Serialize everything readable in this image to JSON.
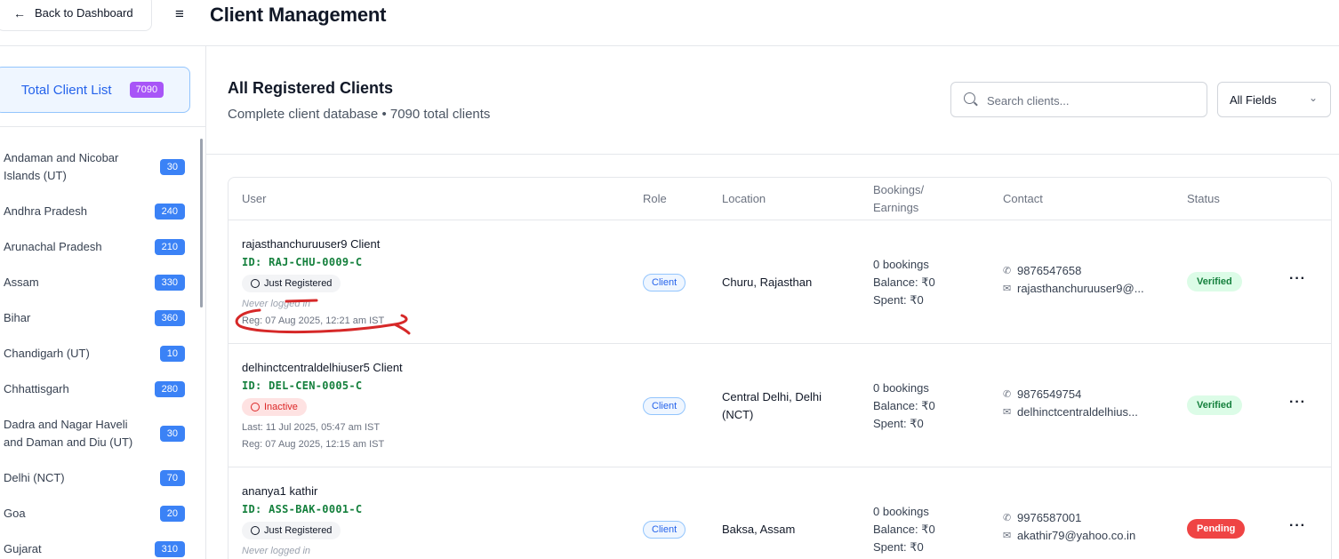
{
  "header": {
    "back_label": "Back to Dashboard",
    "title": "Client Management"
  },
  "sidebar": {
    "total_label": "Total Client List",
    "total_count": "7090",
    "items": [
      {
        "label": "Andaman and Nicobar Islands (UT)",
        "count": "30"
      },
      {
        "label": "Andhra Pradesh",
        "count": "240"
      },
      {
        "label": "Arunachal Pradesh",
        "count": "210"
      },
      {
        "label": "Assam",
        "count": "330"
      },
      {
        "label": "Bihar",
        "count": "360"
      },
      {
        "label": "Chandigarh (UT)",
        "count": "10"
      },
      {
        "label": "Chhattisgarh",
        "count": "280"
      },
      {
        "label": "Dadra and Nagar Haveli and Daman and Diu (UT)",
        "count": "30"
      },
      {
        "label": "Delhi (NCT)",
        "count": "70"
      },
      {
        "label": "Goa",
        "count": "20"
      },
      {
        "label": "Gujarat",
        "count": "310"
      }
    ]
  },
  "main": {
    "title": "All Registered Clients",
    "subtitle": "Complete client database • 7090 total clients",
    "search_placeholder": "Search clients...",
    "field_select": "All Fields"
  },
  "table": {
    "headers": {
      "user": "User",
      "role": "Role",
      "location": "Location",
      "bookings_line1": "Bookings/",
      "bookings_line2": "Earnings",
      "contact": "Contact",
      "status": "Status"
    },
    "rows": [
      {
        "name": "rajasthanchuruuser9 Client",
        "id": "ID: RAJ-CHU-0009-C",
        "tag": "Just Registered",
        "last": "Never logged in",
        "reg": "Reg: 07 Aug 2025, 12:21 am IST",
        "role": "Client",
        "location": "Churu, Rajasthan",
        "bookings": "0 bookings",
        "balance": "Balance: ₹0",
        "spent": "Spent: ₹0",
        "phone": "9876547658",
        "email": "rajasthanchuruuser9@...",
        "status": "Verified"
      },
      {
        "name": "delhinctcentraldelhiuser5 Client",
        "id": "ID: DEL-CEN-0005-C",
        "tag": "Inactive",
        "last": "Last: 11 Jul 2025, 05:47 am IST",
        "reg": "Reg: 07 Aug 2025, 12:15 am IST",
        "role": "Client",
        "location": "Central Delhi, Delhi (NCT)",
        "bookings": "0 bookings",
        "balance": "Balance: ₹0",
        "spent": "Spent: ₹0",
        "phone": "9876549754",
        "email": "delhinctcentraldelhius...",
        "status": "Verified"
      },
      {
        "name": "ananya1 kathir",
        "id": "ID: ASS-BAK-0001-C",
        "tag": "Just Registered",
        "last": "Never logged in",
        "role": "Client",
        "location": "Baksa, Assam",
        "bookings": "0 bookings",
        "balance": "Balance: ₹0",
        "spent": "Spent: ₹0",
        "phone": "9976587001",
        "email": "akathir79@yahoo.co.in",
        "status": "Pending"
      }
    ],
    "more_menu": "···"
  },
  "colors": {
    "accent": "#2563eb",
    "total_badge": "#a855f7",
    "count_badge": "#3b82f6",
    "verified_bg": "#dcfce7",
    "pending_bg": "#ef4444",
    "id_text": "#15803d",
    "annotation": "#d62828"
  },
  "icons": [
    "arrow-left-icon",
    "menu-icon",
    "search-icon",
    "chevron-down-icon",
    "clock-icon",
    "x-circle-icon",
    "phone-icon",
    "mail-icon",
    "more-horizontal-icon"
  ]
}
